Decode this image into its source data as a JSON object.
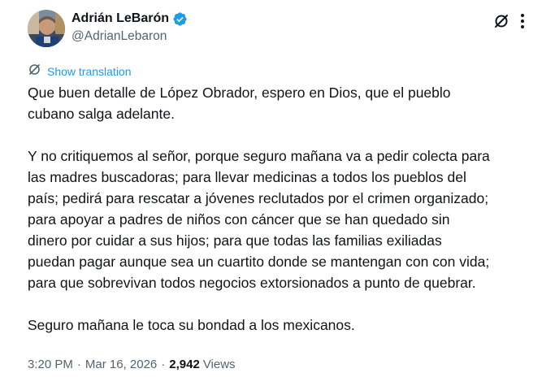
{
  "author": {
    "display_name": "Adrián LeBarón",
    "handle": "@AdrianLebaron",
    "verified": true
  },
  "header_actions": {
    "grok_icon": "grok-slash-circle-icon",
    "more_icon": "vertical-ellipsis-icon"
  },
  "translation": {
    "label": "Show translation",
    "icon": "translate-icon"
  },
  "tweet": {
    "lines": [
      "Que buen detalle de López Obrador,  espero en Dios, que el pueblo",
      "cubano salga adelante.",
      "Y no critiquemos al señor, porque seguro mañana va a pedir colecta para",
      "las madres buscadoras; para llevar medicinas a todos los pueblos del",
      "país; pedirá para rescatar a jóvenes reclutados por el crimen organizado;",
      "para apoyar a padres de niños con cáncer que se han quedado sin",
      "dinero por cuidar a sus hijos; para que todas las familias exiliadas",
      "puedan pagar aunque sea un cuartito donde se mantengan con con vida;",
      "para que sobrevivan todos negocios extorsionados a punto de quebrar.",
      "Seguro mañana le toca su bondad a los mexicanos."
    ]
  },
  "meta": {
    "time": "3:20 PM",
    "separator": "·",
    "date": "Mar 16, 2026",
    "views_count": "2,942",
    "views_label": "Views"
  },
  "colors": {
    "text": "#0f1419",
    "secondary": "#536471",
    "accent": "#1d9bf0"
  }
}
